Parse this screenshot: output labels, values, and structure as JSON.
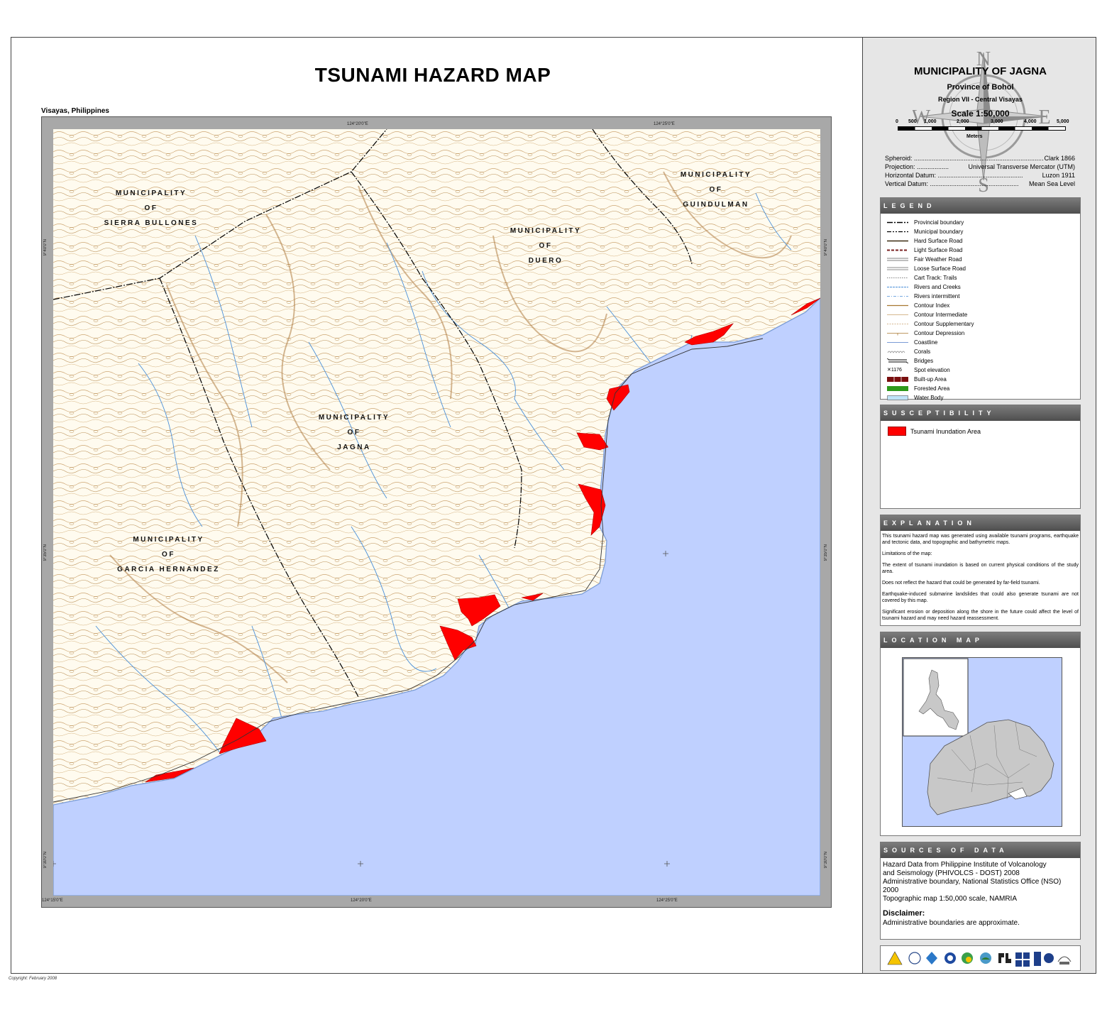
{
  "title": "TSUNAMI HAZARD MAP",
  "subtitle": "Visayas, Philippines",
  "copyright": "Copyright: February 2008",
  "colors": {
    "land": "#fffbef",
    "water": "#bfd0ff",
    "contour": "#b58a4f",
    "river": "#4a8fd8",
    "inundation": "#ff0000",
    "frame": "#a8a8a8",
    "panel_header": "#5e5e5e"
  },
  "map": {
    "graticule": {
      "top": [
        "124°20'0\"E",
        "124°25'0\"E"
      ],
      "bottom": [
        "124°15'0\"E",
        "124°20'0\"E",
        "124°25'0\"E"
      ],
      "left": [
        "9°40'0\"N",
        "9°35'0\"N",
        "9°30'0\"N"
      ],
      "right": [
        "9°40'0\"N",
        "9°35'0\"N",
        "9°30'0\"N"
      ]
    },
    "municipalities": [
      {
        "lines": [
          "MUNICIPALITY",
          "OF",
          "SIERRA BULLONES"
        ]
      },
      {
        "lines": [
          "MUNICIPALITY",
          "OF",
          "DUERO"
        ]
      },
      {
        "lines": [
          "MUNICIPALITY",
          "OF",
          "GUINDULMAN"
        ]
      },
      {
        "lines": [
          "MUNICIPALITY",
          "OF",
          "JAGNA"
        ]
      },
      {
        "lines": [
          "MUNICIPALITY",
          "OF",
          "GARCIA HERNANDEZ"
        ]
      }
    ]
  },
  "header": {
    "municipality": "MUNICIPALITY OF JAGNA",
    "province": "Province of Bohol",
    "region": "Region VII - Central Visayas",
    "scale_label": "Scale 1:50,000",
    "scale_ticks": [
      "0",
      "500",
      "1,000",
      "2,000",
      "3,000",
      "4,000",
      "5,000"
    ],
    "scale_unit": "Meters",
    "compass": {
      "n": "N",
      "s": "S",
      "e": "E",
      "w": "W"
    }
  },
  "datum": [
    {
      "label": "Spheroid: ..........................................................................",
      "value": "Clark 1866"
    },
    {
      "label": "Projection: ..................",
      "value": "Universal Transverse Mercator (UTM)"
    },
    {
      "label": "Horizontal Datum: ................................................",
      "value": "Luzon 1911"
    },
    {
      "label": "Vertical Datum: ..................................................",
      "value": "Mean Sea Level"
    }
  ],
  "legend": {
    "title": "LEGEND",
    "items": [
      {
        "label": "Provincial boundary",
        "symbol": "provincial"
      },
      {
        "label": "Municipal boundary",
        "symbol": "municipal"
      },
      {
        "label": "Hard Surface Road",
        "symbol": "hard-road"
      },
      {
        "label": "Light Surface Road",
        "symbol": "light-road"
      },
      {
        "label": "Fair Weather Road",
        "symbol": "fair-road"
      },
      {
        "label": "Loose Surface Road",
        "symbol": "loose-road"
      },
      {
        "label": "Cart Track: Trails",
        "symbol": "trail"
      },
      {
        "label": "Rivers and Creeks",
        "symbol": "river"
      },
      {
        "label": "Rivers intermittent",
        "symbol": "river-int"
      },
      {
        "label": "Contour Index",
        "symbol": "contour-index"
      },
      {
        "label": "Contour Intermediate",
        "symbol": "contour-inter"
      },
      {
        "label": "Contour Supplementary",
        "symbol": "contour-supp"
      },
      {
        "label": "Contour Depression",
        "symbol": "contour-dep"
      },
      {
        "label": "Coastline",
        "symbol": "coastline"
      },
      {
        "label": "Corals",
        "symbol": "corals"
      },
      {
        "label": "Bridges",
        "symbol": "bridges"
      },
      {
        "label": "Spot elevation",
        "symbol": "spot",
        "sample": "1176"
      },
      {
        "label": "Built-up Area",
        "symbol": "builtup"
      },
      {
        "label": "Forested Area",
        "symbol": "forest"
      },
      {
        "label": "Water Body",
        "symbol": "waterbody"
      }
    ]
  },
  "susceptibility": {
    "title": "SUSCEPTIBILITY",
    "items": [
      {
        "label": "Tsunami Inundation Area",
        "color": "#ff0000"
      }
    ]
  },
  "explanation": {
    "title": "EXPLANATION",
    "paragraphs": [
      "This tsunami hazard map was generated using available tsunami programs, earthquake and tectonic data, and topographic and bathymetric maps.",
      "Limitations of the map:",
      "The extent of tsunami inundation is based on current physical conditions of the study area.",
      "Does not reflect the hazard that could be generated by far-field tsunami.",
      "Earthquake-induced submarine landslides that could also generate tsunami are not covered by this map.",
      "Significant erosion or deposition along the shore in the future could affect the level of tsunami hazard and may need hazard reassessment."
    ]
  },
  "location_map": {
    "title": "LOCATION MAP"
  },
  "sources": {
    "title": "SOURCES OF DATA",
    "lines": [
      "Hazard Data from Philippine Institute of Volcanology",
      "and Seismology (PHIVOLCS - DOST) 2008",
      "Administrative boundary, National Statistics Office (NSO) 2000",
      "Topographic map 1:50,000 scale,  NAMRIA"
    ],
    "disclaimer_title": "Disclaimer:",
    "disclaimer_text": "Administrative boundaries are approximate."
  },
  "logos": [
    "phivolcs-logo",
    "dost-logo",
    "ocd-logo",
    "mgb-logo",
    "pagasa-logo",
    "namria-logo",
    "cbdrm-logo",
    "undp-logo",
    "ausaid-logo",
    "un-logo",
    "australia-logo"
  ]
}
